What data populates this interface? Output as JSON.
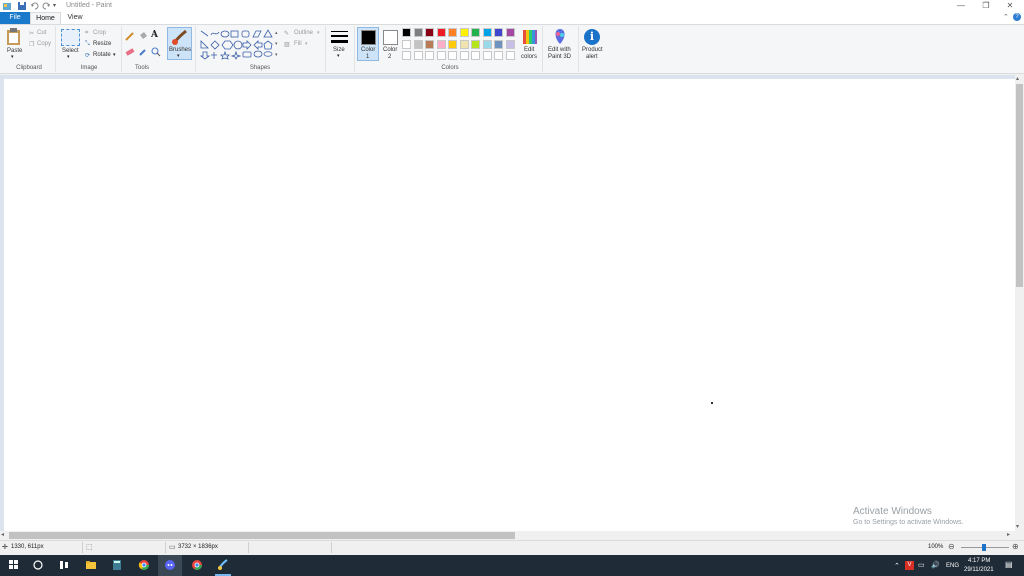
{
  "window": {
    "title": "Untitled - Paint",
    "controls": {
      "minimize": "—",
      "restore": "❐",
      "close": "✕"
    }
  },
  "tabs": {
    "file": "File",
    "home": "Home",
    "view": "View"
  },
  "ribbon": {
    "clipboard": {
      "paste": "Paste",
      "cut": "Cut",
      "copy": "Copy",
      "label": "Clipboard"
    },
    "image": {
      "select": "Select",
      "crop": "Crop",
      "resize": "Resize",
      "rotate": "Rotate",
      "label": "Image"
    },
    "tools": {
      "label": "Tools"
    },
    "brushes": "Brushes",
    "shapes": {
      "outline": "Outline",
      "fill": "Fill",
      "label": "Shapes"
    },
    "size": "Size",
    "color1": [
      "Color",
      "1"
    ],
    "color2": [
      "Color",
      "2"
    ],
    "colors_label": "Colors",
    "edit_colors": [
      "Edit",
      "colors"
    ],
    "edit_paint3d": [
      "Edit with",
      "Paint 3D"
    ],
    "product_alert": [
      "Product",
      "alert"
    ],
    "palette": [
      "#000000",
      "#7f7f7f",
      "#880015",
      "#ed1c24",
      "#ff7f27",
      "#fff200",
      "#22b14c",
      "#00a2e8",
      "#3f48cc",
      "#a349a4",
      "#ffffff",
      "#c3c3c3",
      "#b97a57",
      "#ffaec9",
      "#ffc90e",
      "#efe4b0",
      "#b5e61d",
      "#99d9ea",
      "#7092be",
      "#c8bfe7"
    ]
  },
  "status": {
    "cursor_pos": "1330, 611px",
    "image_size": "3732 × 1836px",
    "zoom": "100%"
  },
  "watermark": {
    "line1": "Activate Windows",
    "line2": "Go to Settings to activate Windows."
  },
  "tray": {
    "language": "ENG",
    "time": "4:17 PM",
    "date": "29/11/2021"
  }
}
